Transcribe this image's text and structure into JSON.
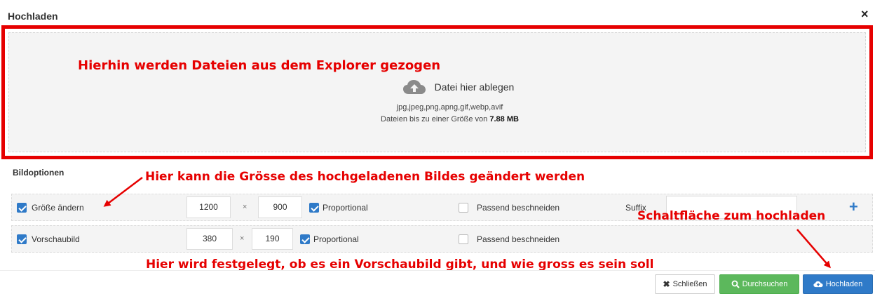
{
  "dialog": {
    "title": "Hochladen",
    "close_symbol": "×"
  },
  "dropzone": {
    "annotation": "Hierhin werden Dateien aus dem Explorer gezogen",
    "icon": "cloud-upload-icon",
    "drop_label": "Datei hier ablegen",
    "file_types": "jpg,jpeg,png,apng,gif,webp,avif",
    "size_prefix": "Dateien bis zu einer Größe von",
    "size_value": "7.88 MB"
  },
  "options": {
    "title": "Bildoptionen",
    "annotation": "Hier kann die Grösse des hochgeladenen Bildes geändert werden",
    "resize_row": {
      "checkbox_label": "Größe ändern",
      "checked": true,
      "width": "1200",
      "times": "×",
      "height": "900",
      "proportional_label": "Proportional",
      "proportional_checked": true,
      "crop_label": "Passend beschneiden",
      "crop_checked": false,
      "suffix_label": "Suffix",
      "suffix_value": ""
    },
    "thumbnail_row": {
      "checkbox_label": "Vorschaubild",
      "checked": true,
      "width": "380",
      "times": "×",
      "height": "190",
      "proportional_label": "Proportional",
      "proportional_checked": true,
      "crop_label": "Passend beschneiden",
      "crop_checked": false
    },
    "add_symbol": "+"
  },
  "annotations": {
    "upload_button": "Schaltfläche zum hochladen",
    "thumbnail": "Hier wird festgelegt, ob es ein Vorschaubild gibt, und wie gross es sein soll"
  },
  "footer": {
    "close_label": "Schließen",
    "browse_label": "Durchsuchen",
    "upload_label": "Hochladen"
  },
  "colors": {
    "annotation_red": "#e60000",
    "primary_blue": "#2f7ac8",
    "success_green": "#5cb85c"
  }
}
